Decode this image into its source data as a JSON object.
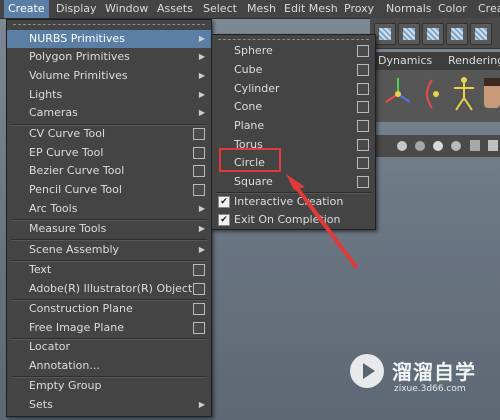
{
  "menubar": {
    "items": [
      "Create",
      "Display",
      "Window",
      "Assets",
      "Select",
      "Mesh",
      "Edit Mesh",
      "Proxy",
      "Normals",
      "Color",
      "Crea"
    ]
  },
  "shelf": {
    "tabs": [
      "Dynamics",
      "Rendering"
    ]
  },
  "create_menu": {
    "items": [
      {
        "label": "NURBS Primitives",
        "kind": "submenu"
      },
      {
        "label": "Polygon Primitives",
        "kind": "submenu"
      },
      {
        "label": "Volume Primitives",
        "kind": "submenu"
      },
      {
        "label": "Lights",
        "kind": "submenu"
      },
      {
        "label": "Cameras",
        "kind": "submenu"
      },
      {
        "label": "CV Curve Tool",
        "kind": "box"
      },
      {
        "label": "EP Curve Tool",
        "kind": "box"
      },
      {
        "label": "Bezier Curve Tool",
        "kind": "box"
      },
      {
        "label": "Pencil Curve Tool",
        "kind": "box"
      },
      {
        "label": "Arc Tools",
        "kind": "submenu"
      },
      {
        "label": "Measure Tools",
        "kind": "submenu"
      },
      {
        "label": "Scene Assembly",
        "kind": "submenu"
      },
      {
        "label": "Text",
        "kind": "box"
      },
      {
        "label": "Adobe(R) Illustrator(R) Object...",
        "kind": "box"
      },
      {
        "label": "Construction Plane",
        "kind": "box"
      },
      {
        "label": "Free Image Plane",
        "kind": "box"
      },
      {
        "label": "Locator",
        "kind": "plain"
      },
      {
        "label": "Annotation...",
        "kind": "plain"
      },
      {
        "label": "Empty Group",
        "kind": "plain"
      },
      {
        "label": "Sets",
        "kind": "submenu"
      }
    ]
  },
  "nurbs_submenu": {
    "items": [
      {
        "label": "Sphere"
      },
      {
        "label": "Cube"
      },
      {
        "label": "Cylinder"
      },
      {
        "label": "Cone"
      },
      {
        "label": "Plane"
      },
      {
        "label": "Torus"
      },
      {
        "label": "Circle"
      },
      {
        "label": "Square"
      }
    ],
    "options": [
      {
        "label": "Interactive Creation",
        "checked": true
      },
      {
        "label": "Exit On Completion",
        "checked": true
      }
    ]
  },
  "watermark": {
    "brand": "溜溜自学",
    "url": "zixue.3d66.com"
  },
  "colors": {
    "highlight": "#5b7ea4",
    "annotation": "#e23a3a"
  }
}
